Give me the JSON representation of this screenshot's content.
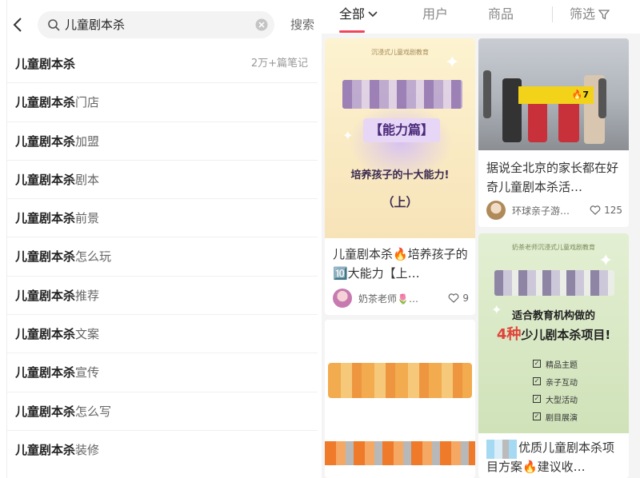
{
  "search": {
    "query": "儿童剧本杀",
    "button_label": "搜索"
  },
  "suggestions": [
    {
      "keyword": "儿童剧本杀",
      "suffix": "",
      "count": "2万+篇笔记"
    },
    {
      "keyword": "儿童剧本杀",
      "suffix": "门店",
      "count": ""
    },
    {
      "keyword": "儿童剧本杀",
      "suffix": "加盟",
      "count": ""
    },
    {
      "keyword": "儿童剧本杀",
      "suffix": "剧本",
      "count": ""
    },
    {
      "keyword": "儿童剧本杀",
      "suffix": "前景",
      "count": ""
    },
    {
      "keyword": "儿童剧本杀",
      "suffix": "怎么玩",
      "count": ""
    },
    {
      "keyword": "儿童剧本杀",
      "suffix": "推荐",
      "count": ""
    },
    {
      "keyword": "儿童剧本杀",
      "suffix": "文案",
      "count": ""
    },
    {
      "keyword": "儿童剧本杀",
      "suffix": "宣传",
      "count": ""
    },
    {
      "keyword": "儿童剧本杀",
      "suffix": "怎么写",
      "count": ""
    },
    {
      "keyword": "儿童剧本杀",
      "suffix": "装修",
      "count": ""
    }
  ],
  "tabs": {
    "all": "全部",
    "users": "用户",
    "goods": "商品",
    "filter": "筛选"
  },
  "cards": {
    "card1": {
      "cover_top": "沉浸式儿童戏剧教育",
      "cover_chip": "【能力篇】",
      "cover_sub": "培养孩子的十大能力!",
      "cover_part": "（上）",
      "title": "儿童剧本杀🔥培养孩子的🔟大能力【上…",
      "author": "奶茶老师🌷…",
      "likes": "9"
    },
    "card2": {
      "banner": "🔥7",
      "title": "据说全北京的家长都在好奇儿童剧本杀活…",
      "author": "环球亲子游…",
      "likes": "125"
    },
    "card3": {
      "cover_top": "奶茶老师沉浸式儿童戏剧教育",
      "cover_l1": "适合教育机构做的",
      "cover_l2_hl": "4种",
      "cover_l2": "少儿剧本杀项目!",
      "checks": [
        "精品主题",
        "亲子互动",
        "大型活动",
        "剧目展演"
      ],
      "title": "优质儿童剧本杀项目方案🔥建议收…"
    }
  },
  "colors": {
    "accent": "#f0465a"
  }
}
